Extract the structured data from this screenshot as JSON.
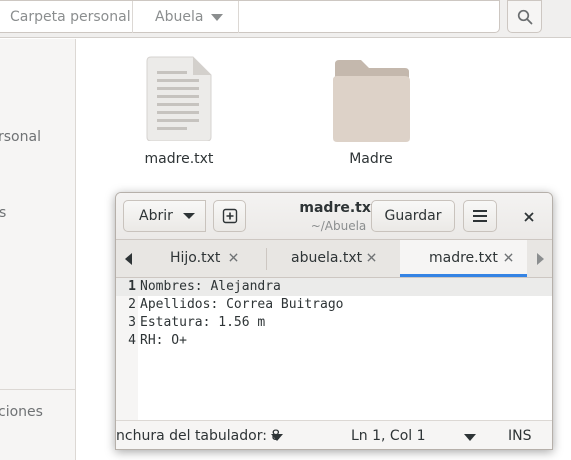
{
  "file_manager": {
    "pathbar": {
      "home": "Carpeta personal",
      "current": "Abuela"
    },
    "sidebar": {
      "items": [
        "rsonal",
        "s",
        "ciones"
      ]
    },
    "files": [
      {
        "name": "madre.txt",
        "icon": "text-file-icon"
      },
      {
        "name": "Madre",
        "icon": "folder-icon"
      }
    ]
  },
  "editor_window": {
    "header": {
      "open_label": "Abrir",
      "title": "madre.txt",
      "subtitle": "~/Abuela",
      "save_label": "Guardar"
    },
    "tabs": [
      {
        "label": "Hijo.txt",
        "active": false
      },
      {
        "label": "abuela.txt",
        "active": false
      },
      {
        "label": "madre.txt",
        "active": true
      }
    ],
    "lines": [
      {
        "num": "1",
        "text": "Nombres: Alejandra"
      },
      {
        "num": "2",
        "text": "Apellidos: Correa Buitrago"
      },
      {
        "num": "3",
        "text": "Estatura: 1.56 m"
      },
      {
        "num": "4",
        "text": "RH: O+"
      }
    ],
    "statusbar": {
      "tab_width": "nchura del tabulador: 8",
      "position": "Ln 1, Col 1",
      "mode": "INS"
    }
  },
  "colors": {
    "accent": "#3584e4",
    "folder": "#d9cec4"
  }
}
